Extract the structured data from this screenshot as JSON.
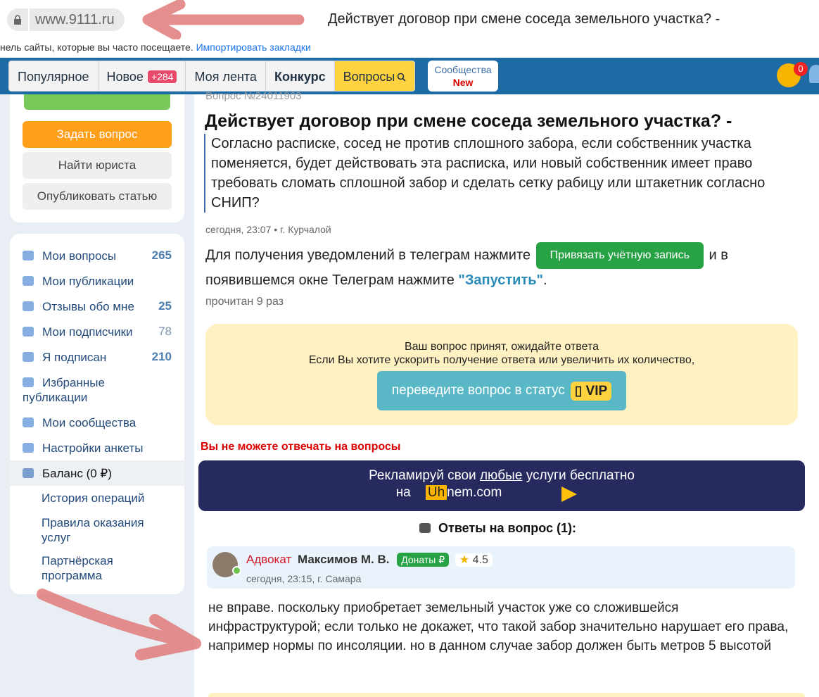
{
  "browser": {
    "url": "www.9111.ru",
    "title": "Действует договор при смене соседа земельного участка? -",
    "bookmarks_text": "нель сайты, которые вы часто посещаете.",
    "bookmarks_link": "Импортировать закладки"
  },
  "nav": {
    "items": [
      {
        "label": "Популярное"
      },
      {
        "label": "Новое",
        "badge": "+284"
      },
      {
        "label": "Моя лента"
      },
      {
        "label": "Конкурс"
      },
      {
        "label": "Вопросы"
      }
    ],
    "community": {
      "label": "Сообщества",
      "new": "New"
    },
    "notifications_count": "0"
  },
  "sidebar": {
    "buttons": {
      "ask": "Задать вопрос",
      "find_lawyer": "Найти юриста",
      "publish": "Опубликовать статью"
    },
    "menu": [
      {
        "label": "Мои вопросы",
        "count": "265"
      },
      {
        "label": "Мои публикации",
        "count": ""
      },
      {
        "label": "Отзывы обо мне",
        "count": "25"
      },
      {
        "label": "Мои подписчики",
        "count": "78"
      },
      {
        "label": "Я подписан",
        "count": "210"
      },
      {
        "label": "Избранные публикации",
        "count": ""
      },
      {
        "label": "Мои сообщества",
        "count": ""
      },
      {
        "label": "Настройки анкеты",
        "count": ""
      }
    ],
    "balance": "Баланс (0 ₽)",
    "sub_menu": [
      {
        "label": "История операций"
      },
      {
        "label": "Правила оказания услуг"
      },
      {
        "label": "Партнёрская программа"
      }
    ]
  },
  "question": {
    "number": "Вопрос №24011903",
    "title": "Действует договор при смене соседа земельного участка? -",
    "text": "Согласно расписке, сосед не против сплошного забора, если собственник участка поменяется, будет действовать эта расписка, или новый собственник имеет право требовать сломать сплошной забор и сделать сетку рабицу или штакетник согласно СНИП?",
    "meta": "сегодня, 23:07 • г. Курчалой",
    "telegram_before": "Для получения уведомлений в телеграм нажмите",
    "telegram_button": "Привязать учётную запись",
    "telegram_after": "и в появившемся окне Телеграм нажмите",
    "telegram_link": "\"Запустить\"",
    "telegram_end": ".",
    "read_count": "прочитан 9 раз"
  },
  "accepted_box": {
    "line1": "Ваш вопрос принят, ожидайте ответа",
    "line2": "Если Вы хотите ускорить получение ответа или увеличить их количество,",
    "button": "переведите вопрос в статус",
    "vip": "VIP"
  },
  "no_answer_warning": "Вы не можете отвечать на вопросы",
  "ad": {
    "line1_before": "Рекламируй свои",
    "line1_underline": "любые",
    "line1_after": "услуги бесплатно",
    "line2_before": "на",
    "brand_highlight": "Uh",
    "brand_rest": "nem.com"
  },
  "answers": {
    "title": "Ответы на вопрос (1):",
    "items": [
      {
        "role": "Адвокат",
        "name": "Максимов М. В.",
        "donate": "Донаты ₽",
        "rating": "4.5",
        "meta": "сегодня, 23:15,  г. Самара",
        "text": "не вправе. поскольку приобретает земельный участок уже со сложившейся инфраструктурой; если только не докажет, что такой забор значительно нарушает его права, например нормы по инсоляции. но в данном случае забор должен быть метров 5 высотой"
      }
    ]
  },
  "colors": {
    "nav_bg": "#1d6aa5",
    "accent_orange": "#ff9f1a",
    "accent_green": "#27a244",
    "warning_red": "#dd0000",
    "ad_bg": "#272a5f",
    "annotation_arrow": "#e07a7a"
  }
}
